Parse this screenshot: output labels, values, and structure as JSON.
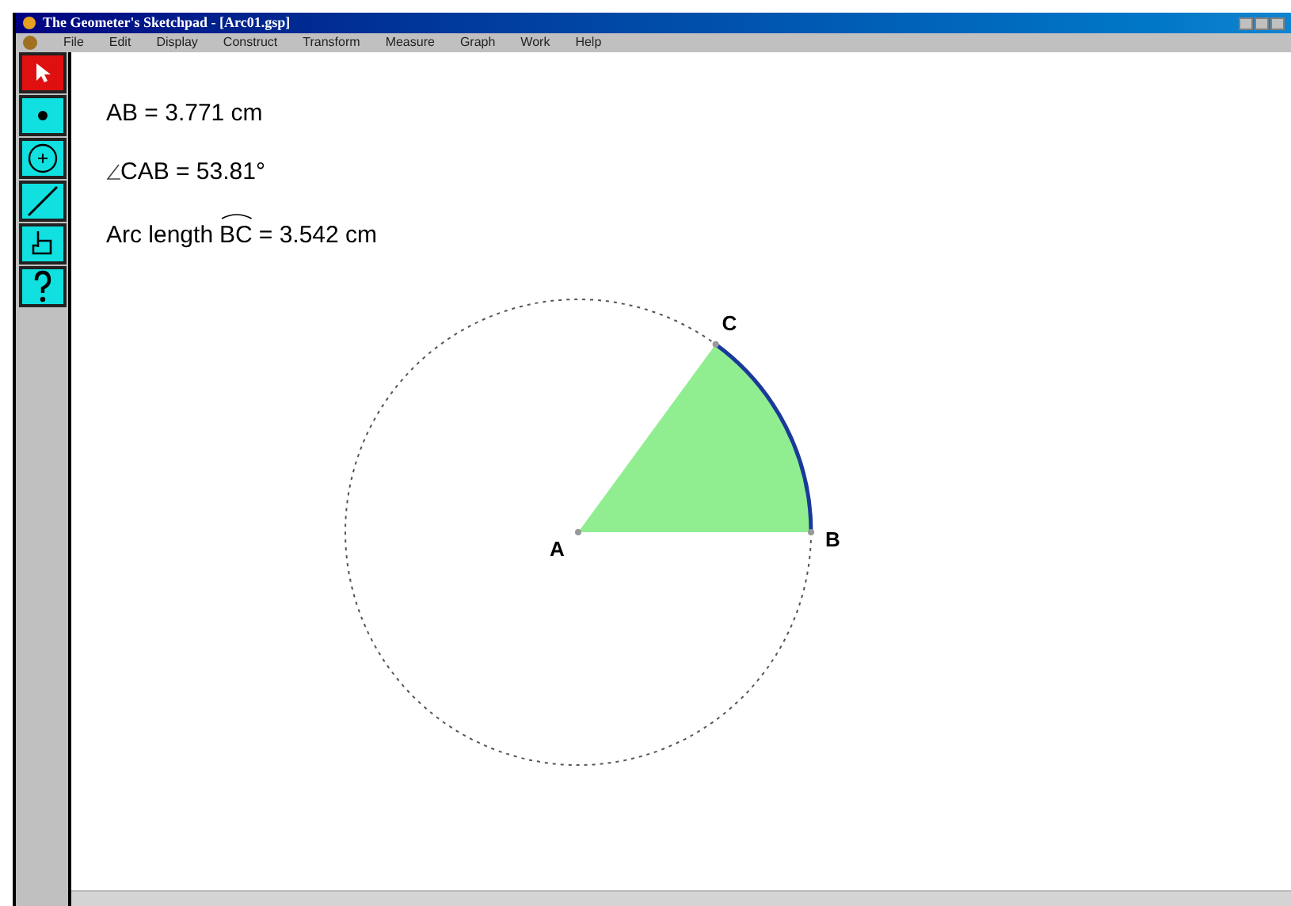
{
  "window": {
    "title": "The Geometer's Sketchpad - [Arc01.gsp]"
  },
  "menu": [
    "File",
    "Edit",
    "Display",
    "Construct",
    "Transform",
    "Measure",
    "Graph",
    "Work",
    "Help"
  ],
  "tools": [
    {
      "kind": "arrow",
      "selected": true
    },
    {
      "kind": "point",
      "selected": false
    },
    {
      "kind": "compass",
      "selected": false
    },
    {
      "kind": "line",
      "selected": false
    },
    {
      "kind": "text",
      "selected": false
    },
    {
      "kind": "help",
      "selected": false
    }
  ],
  "measurements": [
    {
      "kind": "plain",
      "text": "AB = 3.771 cm"
    },
    {
      "kind": "angle",
      "text": "CAB = 53.81°"
    },
    {
      "kind": "arc",
      "prefix": "Arc length",
      "arc": "BC",
      "text": "= 3.542 cm"
    }
  ],
  "sketch": {
    "points": [
      {
        "label": "A"
      },
      {
        "label": "B"
      },
      {
        "label": "C"
      }
    ]
  }
}
